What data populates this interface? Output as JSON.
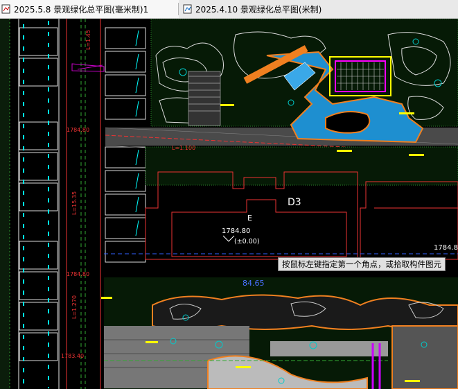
{
  "tabs": [
    {
      "label": "2025.5.8 景观绿化总平图(毫米制)1",
      "active": true
    },
    {
      "label": "2025.4.10 景观绿化总平图(米制)",
      "active": false
    }
  ],
  "drawing": {
    "building_label": "D3",
    "elev_main": "1784.80",
    "elev_zero": "(±0.00)",
    "elev_right": "1784.80",
    "elev_bottom_blue": "84.65",
    "elev_left_1": "1784.80",
    "elev_left_2": "1784.80",
    "elev_left_3": "1783.40",
    "slope_left": "L=1.100",
    "slope_left_2": "L=15.35",
    "slope_left_3": "L=1.270",
    "slope_top": "L=1.45",
    "room_marker": "E"
  },
  "tooltip": "按鼠标左键指定第一个角点，或拾取构件图元"
}
